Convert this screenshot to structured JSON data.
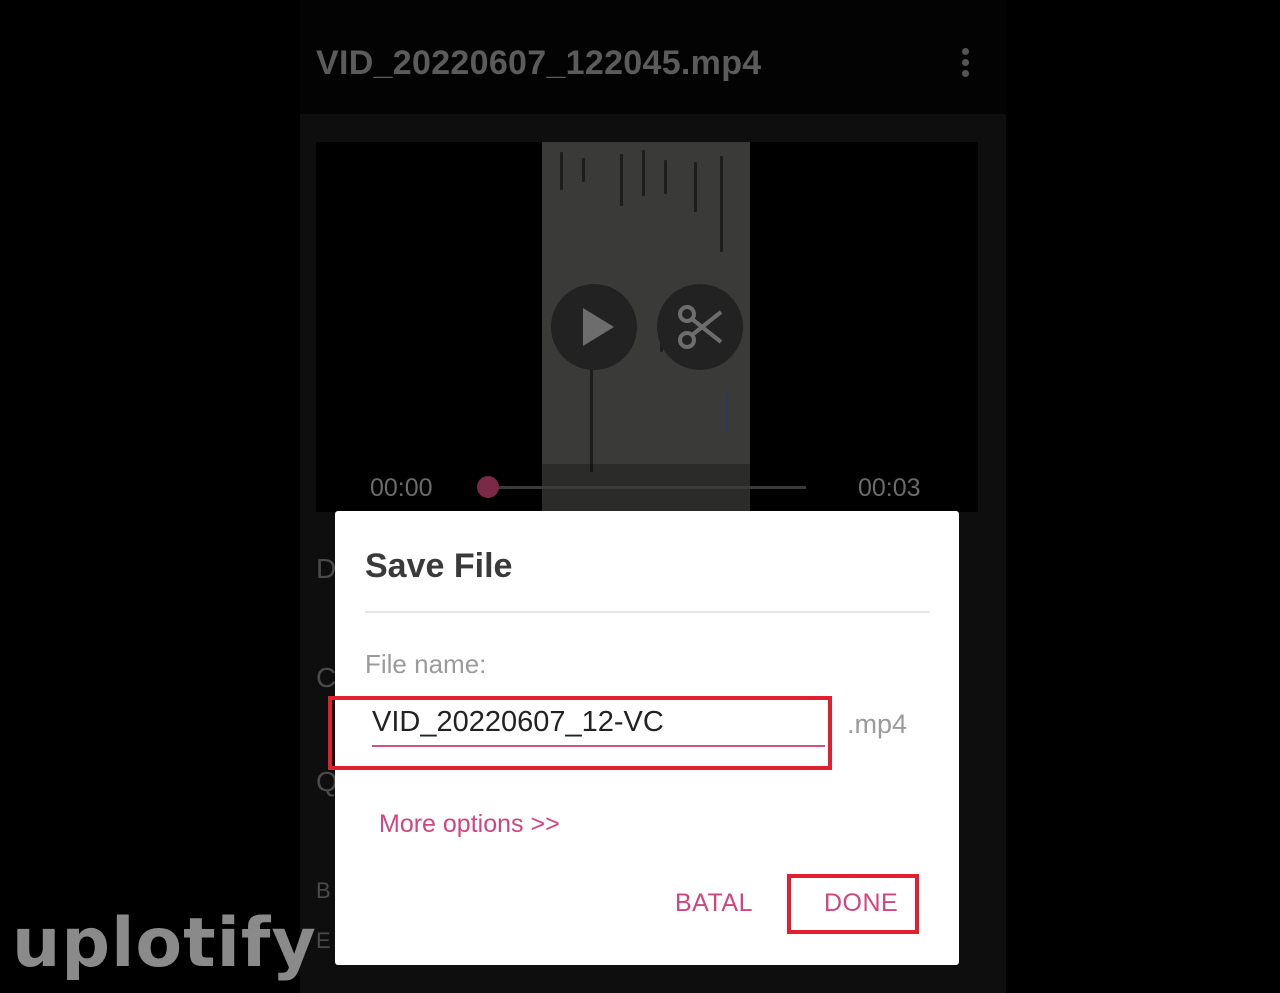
{
  "app": {
    "title": "VID_20220607_122045.mp4",
    "menu_icon": "more-vertical-icon"
  },
  "player": {
    "play_icon": "play-icon",
    "cut_icon": "scissors-icon",
    "time_current": "00:00",
    "time_total": "00:03",
    "progress": 0
  },
  "background_rows": {
    "row1": "D",
    "row2": "C",
    "row3": "Q",
    "row4": "B",
    "row5": "E"
  },
  "dialog": {
    "title": "Save File",
    "field_label": "File name:",
    "filename_value": "VID_20220607_12-VC",
    "extension": ".mp4",
    "more_options": "More options >>",
    "cancel_label": "BATAL",
    "done_label": "DONE"
  },
  "watermark": "uplotify",
  "colors": {
    "accent": "#d1457f",
    "highlight": "#e01f2f",
    "dialog_bg": "#ffffff"
  }
}
